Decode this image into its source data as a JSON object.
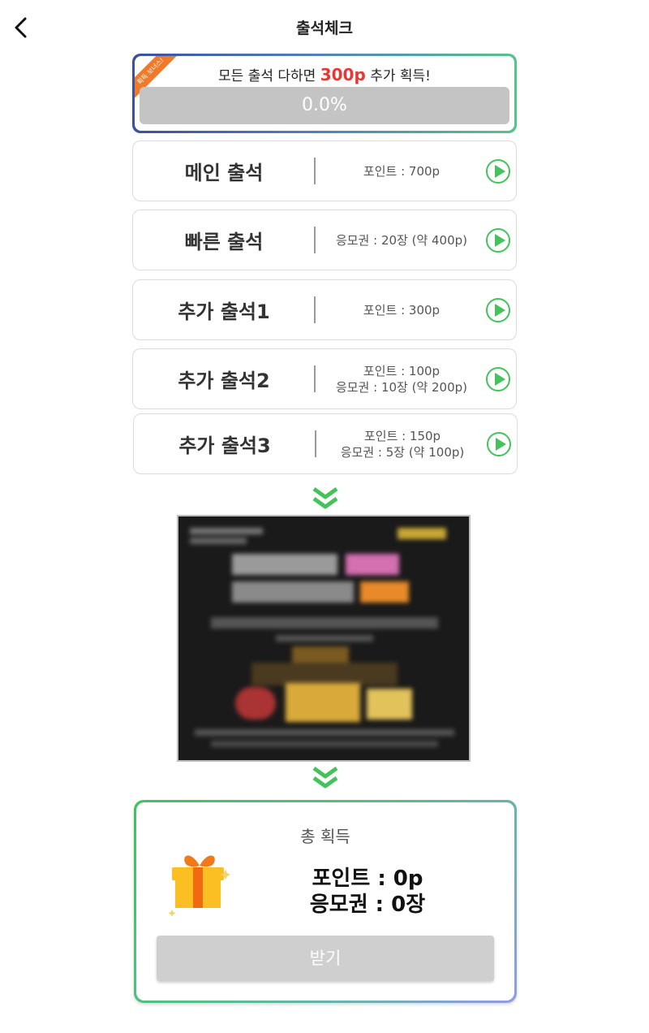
{
  "header": {
    "title": "출석체크",
    "back_icon": "chevron-left-icon"
  },
  "bonus": {
    "ribbon": "획득 보너스!",
    "text_before": "모든 출석 다하면",
    "highlight": "300p",
    "text_after": "추가 획득!",
    "progress_label": "0.0%",
    "progress_fraction": 0.0,
    "highlight_color": "#e53935"
  },
  "attendance": [
    {
      "name": "메인 출석",
      "rewards": [
        "포인트 : 700p"
      ]
    },
    {
      "name": "빠른 출석",
      "rewards": [
        "응모권 : 20장 (약 400p)"
      ]
    },
    {
      "name": "추가 출석1",
      "rewards": [
        "포인트 : 300p"
      ]
    },
    {
      "name": "추가 출석2",
      "rewards": [
        "포인트 : 100p",
        "응모권 : 10장 (약 200p)"
      ]
    },
    {
      "name": "추가 출석3",
      "rewards": [
        "포인트 : 150p",
        "응모권 : 5장 (약 100p)"
      ]
    }
  ],
  "total": {
    "title": "총 획득",
    "points": "포인트 : 0p",
    "tickets": "응모권 : 0장",
    "claim_label": "받기"
  },
  "colors": {
    "accent_green": "#45c25c",
    "gradient_blue": "#3d4fa0",
    "button_disabled": "#cfcfcf"
  }
}
